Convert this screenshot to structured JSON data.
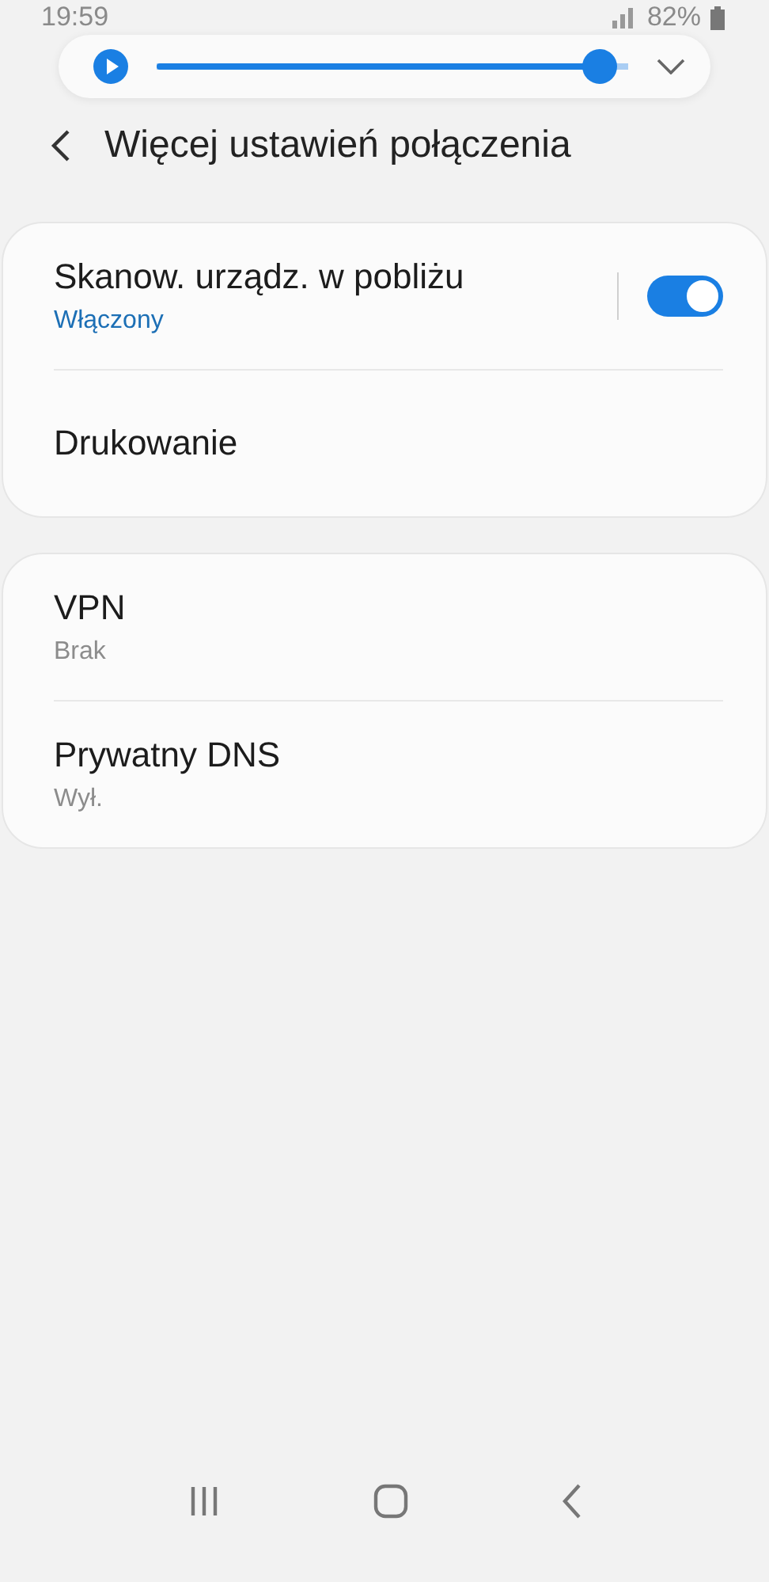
{
  "status_bar": {
    "time": "19:59",
    "battery": "82%"
  },
  "media_bar": {
    "playing": false,
    "level": 0.94
  },
  "header": {
    "title": "Więcej ustawień połączenia"
  },
  "groups": [
    {
      "items": [
        {
          "kind": "switch",
          "title": "Skanow. urządz. w pobliżu",
          "subtitle": "Włączony",
          "on": true
        },
        {
          "kind": "plain",
          "title": "Drukowanie"
        }
      ]
    },
    {
      "items": [
        {
          "kind": "plain",
          "title": "VPN",
          "subtitle": "Brak"
        },
        {
          "kind": "plain",
          "title": "Prywatny DNS",
          "subtitle": "Wył."
        }
      ]
    }
  ]
}
